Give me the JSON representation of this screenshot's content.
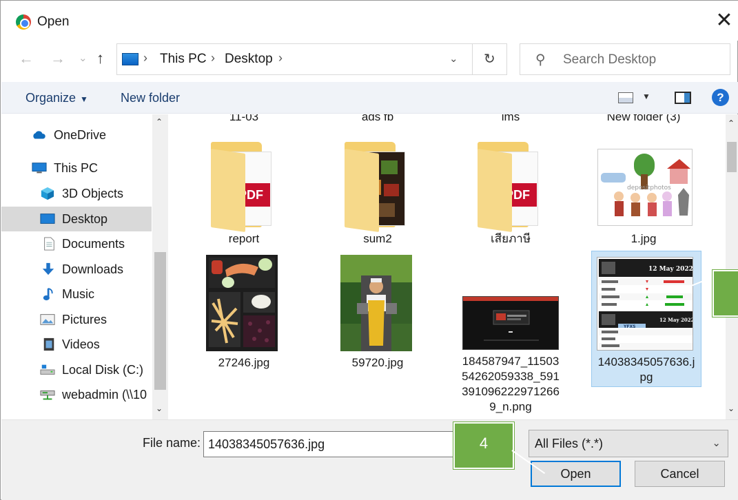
{
  "window": {
    "title": "Open",
    "close_glyph": "✕"
  },
  "address": {
    "back_glyph": "←",
    "forward_glyph": "→",
    "recent_glyph": "⌄",
    "up_glyph": "↑",
    "crumbs": [
      "This PC",
      "Desktop"
    ],
    "separator": "›",
    "dropdown_glyph": "⌄",
    "refresh_glyph": "↻",
    "search_placeholder": "Search Desktop",
    "search_glyph": "⚲"
  },
  "toolbar": {
    "organize_label": "Organize",
    "organize_caret": "▼",
    "new_folder_label": "New folder",
    "view_caret": "▼",
    "help_label": "?"
  },
  "nav": {
    "items": [
      {
        "label": "OneDrive",
        "icon": "cloud-icon",
        "selected": false
      },
      {
        "label": "This PC",
        "icon": "computer-icon",
        "selected": false
      },
      {
        "label": "3D Objects",
        "icon": "cube-icon",
        "selected": false
      },
      {
        "label": "Desktop",
        "icon": "desktop-icon",
        "selected": true
      },
      {
        "label": "Documents",
        "icon": "document-icon",
        "selected": false
      },
      {
        "label": "Downloads",
        "icon": "download-icon",
        "selected": false
      },
      {
        "label": "Music",
        "icon": "music-icon",
        "selected": false
      },
      {
        "label": "Pictures",
        "icon": "picture-icon",
        "selected": false
      },
      {
        "label": "Videos",
        "icon": "video-icon",
        "selected": false
      },
      {
        "label": "Local Disk (C:)",
        "icon": "disk-icon",
        "selected": false
      },
      {
        "label": "webadmin (\\\\10",
        "icon": "network-drive-icon",
        "selected": false
      }
    ],
    "scroll_up": "⌃",
    "scroll_down": "⌄"
  },
  "files": {
    "top_row_labels": [
      "11-03",
      "ads fb",
      "lms",
      "New folder (3)"
    ],
    "row1": [
      {
        "name": "report",
        "kind": "folder-pdf"
      },
      {
        "name": "sum2",
        "kind": "folder-photos"
      },
      {
        "name": "เสียภาษี",
        "kind": "folder-pdf"
      },
      {
        "name": "1.jpg",
        "kind": "image-cartoon"
      }
    ],
    "row2": [
      {
        "name": "27246.jpg",
        "kind": "image-food"
      },
      {
        "name": "59720.jpg",
        "kind": "image-person"
      },
      {
        "name": "184587947_11503\n54262059338_591\n391096222971266\n9_n.png",
        "kind": "image-screen"
      },
      {
        "name": "14038345057636.j\npg",
        "kind": "image-table",
        "selected": true
      }
    ],
    "pdf_badge": "PDF",
    "watermark": "depositphotos",
    "thumb_texts": {
      "table_date": "12 May 2022",
      "table_brand": "YFXS"
    },
    "scroll_up": "⌃",
    "scroll_down": "⌄"
  },
  "bottom": {
    "file_name_label": "File name:",
    "file_name_value": "14038345057636.jpg",
    "file_type_label": "All Files (*.*)",
    "file_type_caret": "⌄",
    "open_label": "Open",
    "cancel_label": "Cancel"
  },
  "annotations": {
    "step_label": "4",
    "color": "#70ad47"
  }
}
